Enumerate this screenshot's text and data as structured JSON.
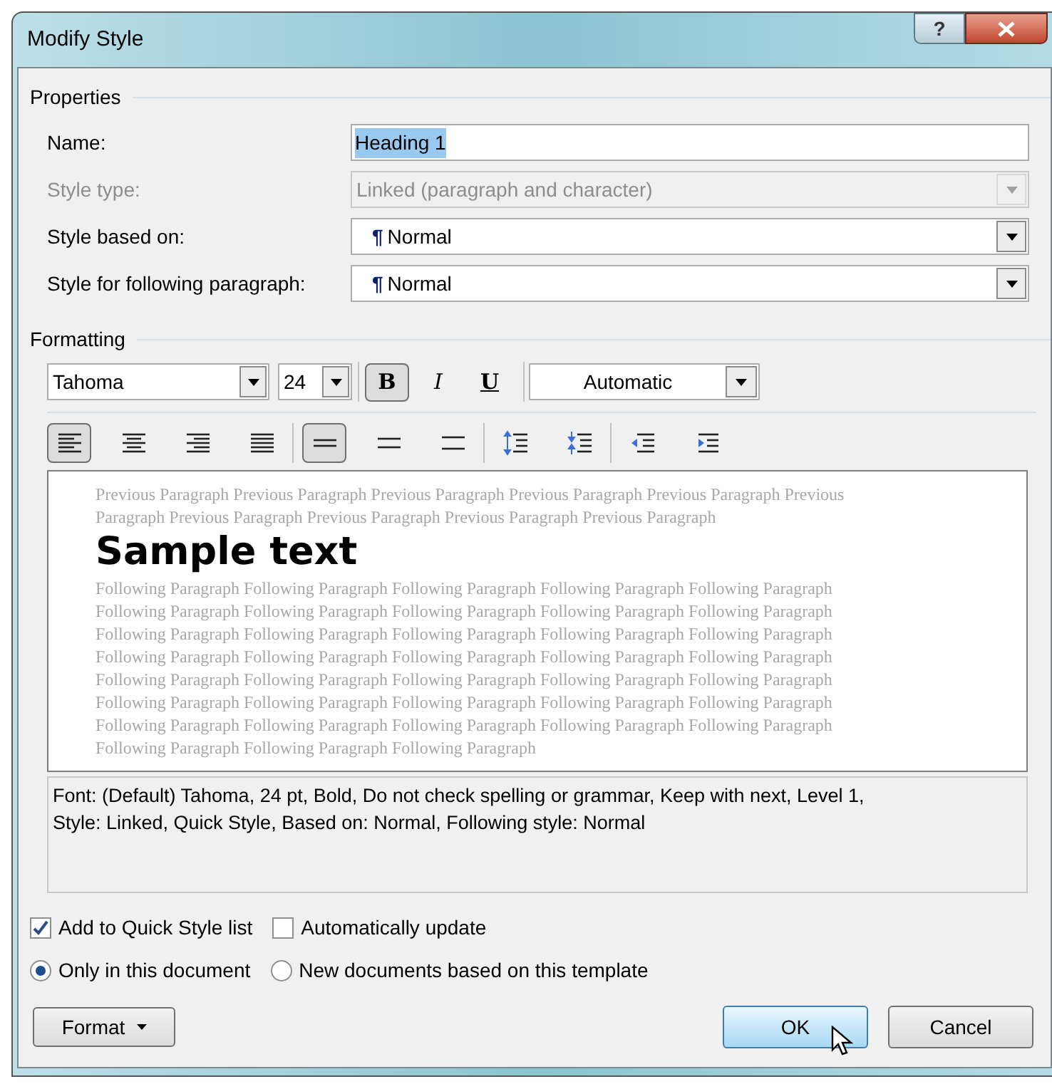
{
  "window": {
    "title": "Modify Style",
    "help": "?"
  },
  "properties": {
    "heading": "Properties",
    "fields": [
      {
        "label": "Name:",
        "value": "Heading 1",
        "kind": "text",
        "highlighted": true,
        "disabled": false
      },
      {
        "label": "Style type:",
        "value": "Linked (paragraph and character)",
        "kind": "dropdown",
        "disabled": true
      },
      {
        "label": "Style based on:",
        "value": "Normal",
        "mark": "¶",
        "kind": "dropdown",
        "disabled": false
      },
      {
        "label": "Style for following paragraph:",
        "value": "Normal",
        "mark": "¶",
        "kind": "dropdown",
        "disabled": false
      }
    ]
  },
  "formatting": {
    "heading": "Formatting",
    "font": "Tahoma",
    "size": "24",
    "font_color_label": "Automatic",
    "styles": [
      {
        "label": "B",
        "kind": "bold",
        "selected": true
      },
      {
        "label": "I",
        "kind": "italic",
        "selected": false
      },
      {
        "label": "U",
        "kind": "underline",
        "selected": false
      }
    ],
    "paragraph_groups": [
      [
        {
          "kind": "align-left",
          "selected": true
        },
        {
          "kind": "align-center",
          "selected": false
        },
        {
          "kind": "align-right",
          "selected": false
        },
        {
          "kind": "justify",
          "selected": false
        }
      ],
      [
        {
          "kind": "single-spacing",
          "selected": true
        },
        {
          "kind": "one-half-spacing",
          "selected": false
        },
        {
          "kind": "double-spacing",
          "selected": false
        }
      ],
      [
        {
          "kind": "increase-spacing",
          "selected": false
        },
        {
          "kind": "decrease-spacing",
          "selected": false
        }
      ],
      [
        {
          "kind": "decrease-indent",
          "selected": false
        },
        {
          "kind": "increase-indent",
          "selected": false
        }
      ]
    ]
  },
  "preview": {
    "previous": [
      "Previous Paragraph Previous Paragraph Previous Paragraph Previous Paragraph Previous Paragraph Previous",
      "Paragraph Previous Paragraph Previous Paragraph Previous Paragraph Previous Paragraph"
    ],
    "sample": "Sample text",
    "following": [
      "Following Paragraph Following Paragraph Following Paragraph Following Paragraph Following Paragraph",
      "Following Paragraph Following Paragraph Following Paragraph Following Paragraph Following Paragraph",
      "Following Paragraph Following Paragraph Following Paragraph Following Paragraph Following Paragraph",
      "Following Paragraph Following Paragraph Following Paragraph Following Paragraph Following Paragraph",
      "Following Paragraph Following Paragraph Following Paragraph Following Paragraph Following Paragraph",
      "Following Paragraph Following Paragraph Following Paragraph Following Paragraph Following Paragraph",
      "Following Paragraph Following Paragraph Following Paragraph Following Paragraph Following Paragraph",
      "Following Paragraph Following Paragraph Following Paragraph"
    ]
  },
  "description": [
    "Font: (Default) Tahoma, 24 pt, Bold, Do not check spelling or grammar, Keep with next, Level 1,",
    "Style: Linked, Quick Style, Based on: Normal, Following style: Normal"
  ],
  "options": {
    "checkboxes": [
      {
        "label": "Add to Quick Style list",
        "checked": true
      },
      {
        "label": "Automatically update",
        "checked": false
      }
    ],
    "radios": [
      {
        "label": "Only in this document",
        "selected": true
      },
      {
        "label": "New documents based on this template",
        "selected": false
      }
    ]
  },
  "buttons": {
    "format": "Format",
    "ok": "OK",
    "cancel": "Cancel"
  }
}
